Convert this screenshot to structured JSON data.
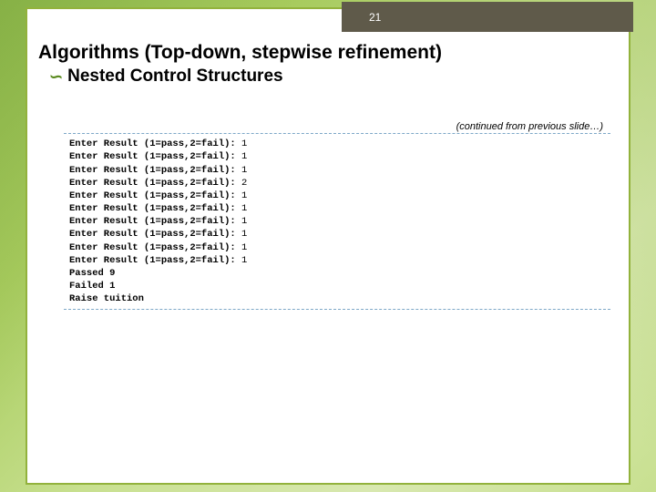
{
  "page_number": "21",
  "title": "Algorithms (Top-down, stepwise refinement)",
  "subtitle": "Nested Control Structures",
  "continued_note": "(continued from previous slide…)",
  "code": {
    "prompt": "Enter Result (1=pass,2=fail): ",
    "inputs": [
      "1",
      "1",
      "1",
      "2",
      "1",
      "1",
      "1",
      "1",
      "1",
      "1"
    ],
    "summary_passed_label": "Passed ",
    "summary_passed_value": "9",
    "summary_failed_label": "Failed ",
    "summary_failed_value": "1",
    "final_line": "Raise tuition"
  }
}
